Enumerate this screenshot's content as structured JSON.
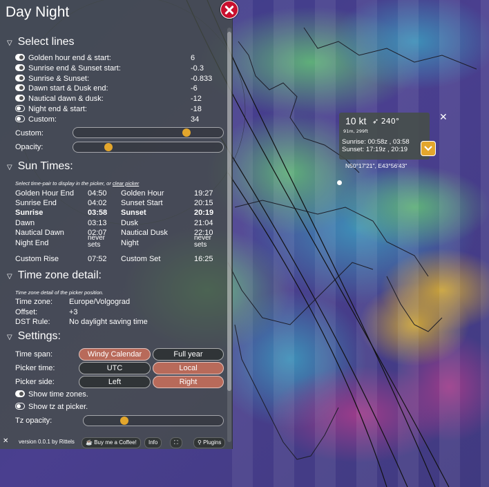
{
  "panel": {
    "title": "Day Night",
    "select_lines_header": "Select lines",
    "lines": [
      {
        "label": "Golden hour end & start:",
        "value": "6",
        "on": true
      },
      {
        "label": "Sunrise end & Sunset start:",
        "value": "-0.3",
        "on": true
      },
      {
        "label": "Sunrise & Sunset:",
        "value": "-0.833",
        "on": true
      },
      {
        "label": "Dawn start & Dusk end:",
        "value": "-6",
        "on": true
      },
      {
        "label": "Nautical dawn & dusk:",
        "value": "-12",
        "on": true
      },
      {
        "label": "Night end & start:",
        "value": "-18",
        "on": false
      },
      {
        "label": "Custom:",
        "value": "34",
        "on": false
      }
    ],
    "custom_slider_label": "Custom:",
    "custom_slider_level": 0.78,
    "opacity_label": "Opacity:",
    "opacity_level": 0.22,
    "sun_times_header": "Sun Times:",
    "sun_times_note": "Select time-pair to display in the picker, or",
    "sun_times_note_link": "clear picker",
    "sun_times": [
      {
        "l1": "Golden Hour End",
        "v1": "04:50",
        "l2": "Golden Hour",
        "v2": "19:27",
        "bold": false
      },
      {
        "l1": "Sunrise End",
        "v1": "04:02",
        "l2": "Sunset Start",
        "v2": "20:15",
        "bold": false
      },
      {
        "l1": "Sunrise",
        "v1": "03:58",
        "l2": "Sunset",
        "v2": "20:19",
        "bold": true
      },
      {
        "l1": "Dawn",
        "v1": "03:13",
        "l2": "Dusk",
        "v2": "21:04",
        "bold": false
      },
      {
        "l1": "Nautical Dawn",
        "v1": "02:07",
        "l2": "Nautical Dusk",
        "v2": "22:10",
        "bold": false
      },
      {
        "l1": "Night End",
        "v1": "never sets",
        "l2": "Night",
        "v2": "never sets",
        "bold": false
      },
      {
        "l1": "Custom Rise",
        "v1": "07:52",
        "l2": "Custom Set",
        "v2": "16:25",
        "bold": false
      }
    ],
    "tz_header": "Time zone detail:",
    "tz_note": "Time zone detail of the picker position.",
    "tz_rows": [
      {
        "label": "Time zone:",
        "value": "Europe/Volgograd"
      },
      {
        "label": "Offset:",
        "value": "+3"
      },
      {
        "label": "DST Rule:",
        "value": "No daylight saving time"
      }
    ],
    "settings_header": "Settings:",
    "settings": {
      "time_span_label": "Time span:",
      "time_span_options": [
        "Windy Calendar",
        "Full year"
      ],
      "picker_time_label": "Picker time:",
      "picker_time_options": [
        "UTC",
        "Local"
      ],
      "picker_side_label": "Picker side:",
      "picker_side_options": [
        "Left",
        "Right"
      ],
      "show_tz_label": "Show time zones.",
      "show_tz_picker_label": "Show tz at picker.",
      "tz_opacity_label": "Tz opacity:",
      "tz_opacity_level": 0.28
    },
    "footer": {
      "version": "version 0.0.1 by Rittels",
      "coffee": "Buy me a Coffee!",
      "info": "Info",
      "plugins": "Plugins"
    }
  },
  "picker": {
    "wind": "10 kt",
    "direction": "240°",
    "altitude": "91m, 299ft",
    "sunrise": "Sunrise: 00:58z , 03:58",
    "sunset": "Sunset: 17:19z , 20:19",
    "coords": "N50°17'21\", E43°56'43\""
  },
  "colors": {
    "accent": "#e3a62c",
    "active_button": "#b86a5a",
    "close_red": "#c8102e"
  }
}
